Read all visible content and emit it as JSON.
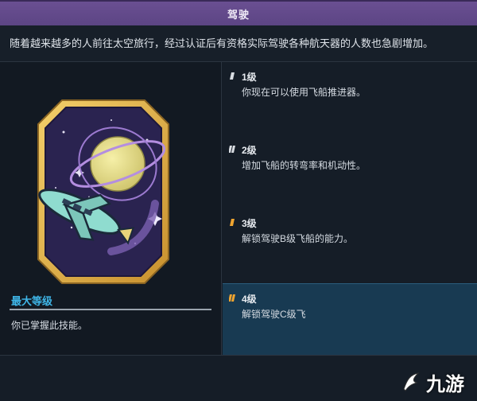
{
  "header": {
    "title": "驾驶"
  },
  "description": "随着越来越多的人前往太空旅行，经过认证后有资格实际驾驶各种航天器的人数也急剧增加。",
  "badge": {
    "icon": "piloting-skill-badge-icon"
  },
  "max_rank": {
    "label": "最大等级",
    "description": "你已掌握此技能。"
  },
  "levels": [
    {
      "name": "1级",
      "description": "你现在可以使用飞船推进器。",
      "tick_color": "#d9dde2"
    },
    {
      "name": "2级",
      "description": "增加飞船的转弯率和机动性。",
      "tick_color": "#d9dde2"
    },
    {
      "name": "3级",
      "description": "解锁驾驶B级飞船的能力。",
      "tick_color": "#f0a530"
    },
    {
      "name": "4级",
      "description": "解锁驾驶C级飞",
      "tick_color": "#f0a530"
    }
  ],
  "watermark": {
    "text": "九游"
  }
}
